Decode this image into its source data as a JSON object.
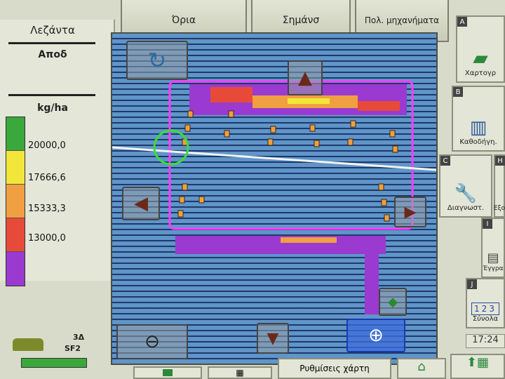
{
  "tabs": [
    {
      "label": "Όρια"
    },
    {
      "label": "Σημάνσ"
    },
    {
      "label": "Πολ. μηχανήματα"
    }
  ],
  "legend": {
    "title": "Λεζάντα",
    "subtitle": "Αποδ",
    "unit": "kg/ha",
    "entries": [
      {
        "value": "20000,0",
        "color": "#f2e63a"
      },
      {
        "value": "17666,6",
        "color": "#f0a040"
      },
      {
        "value": "15333,3",
        "color": "#e84a3a"
      },
      {
        "value": "13000,0",
        "color": "#9a3ad0"
      }
    ],
    "top_color": "#3aa83a"
  },
  "machine": {
    "line1": "3Δ",
    "line2": "SF2"
  },
  "sidebar": [
    {
      "letter": "A",
      "label": "Χαρτογρ"
    },
    {
      "letter": "B",
      "label": "Καθοδήγη."
    },
    {
      "letter": "C",
      "label": "Διαγνωστ."
    },
    {
      "letter": "H",
      "label": "Εξο"
    },
    {
      "letter": "I",
      "label": "Έγγρα"
    },
    {
      "letter": "J",
      "label": "Σύνολα"
    }
  ],
  "counter": {
    "digits": "123"
  },
  "clock": "17:24",
  "bottom": {
    "map_settings": "Ρυθμίσεις χάρτη"
  }
}
